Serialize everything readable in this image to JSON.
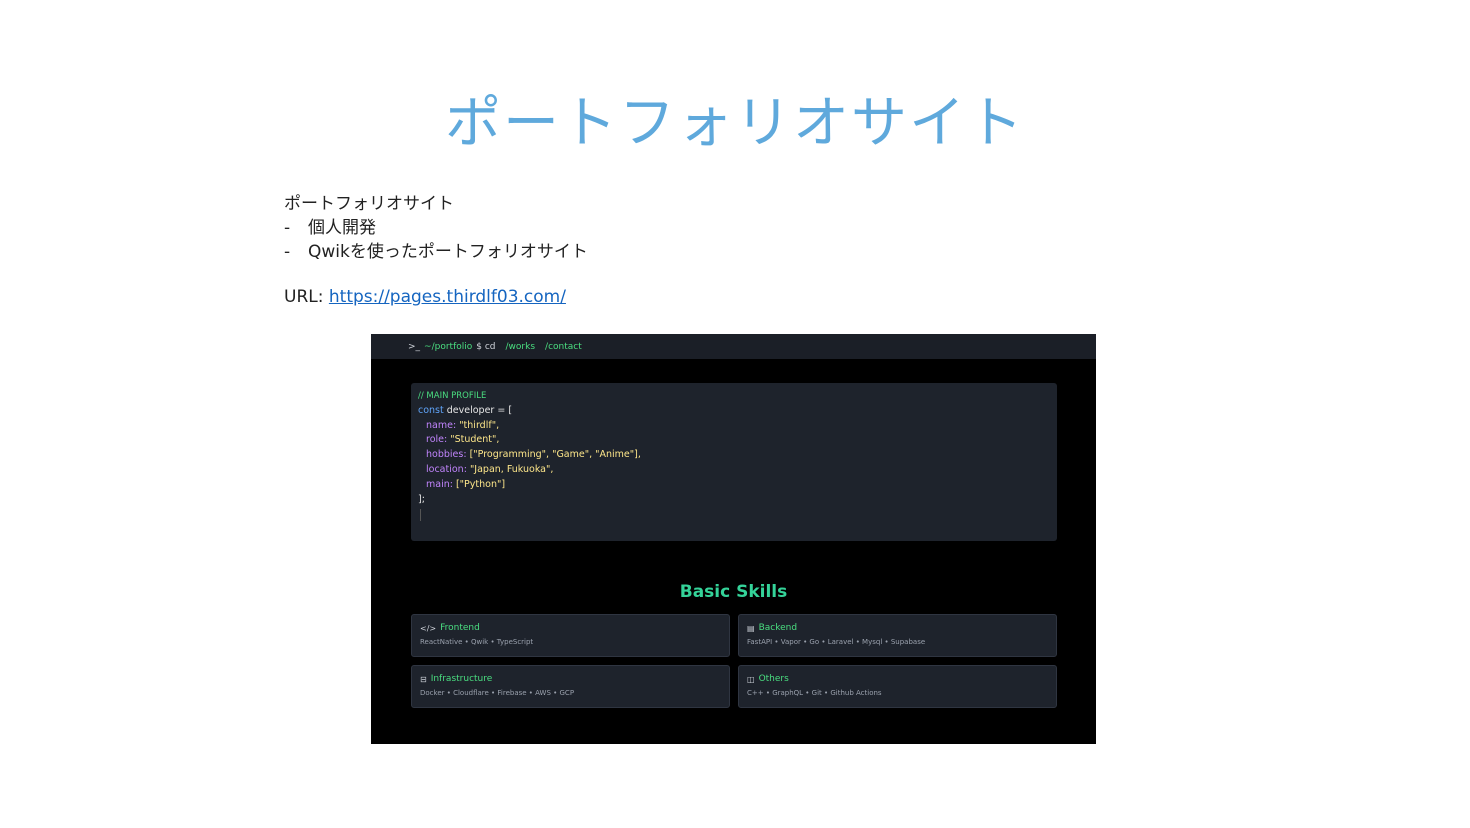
{
  "slide": {
    "title": "ポートフォリオサイト",
    "heading": "ポートフォリオサイト",
    "bullets": [
      "個人開発",
      "Qwikを使ったポートフォリオサイト"
    ],
    "bullet_mark": "-",
    "url_label": "URL:",
    "url": "https://pages.thirdlf03.com/"
  },
  "screenshot": {
    "nav": {
      "prompt": ">_",
      "path": "~/portfolio",
      "command": "$ cd",
      "links": [
        "/works",
        "/contact"
      ]
    },
    "code": {
      "comment": "// MAIN PROFILE",
      "keyword": "const",
      "decl": "developer = [",
      "lines": [
        {
          "key": "name:",
          "value": "\"thirdlf\","
        },
        {
          "key": "role:",
          "value": "\"Student\","
        },
        {
          "key": "hobbies:",
          "value": "[\"Programming\", \"Game\", \"Anime\"],"
        },
        {
          "key": "location:",
          "value": "\"Japan, Fukuoka\","
        },
        {
          "key": "main:",
          "value": "[\"Python\"]"
        }
      ],
      "close": "];"
    },
    "skills_title": "Basic Skills",
    "skills": [
      {
        "icon": "code-icon",
        "glyph": "</>",
        "title": "Frontend",
        "items": "ReactNative • Qwik • TypeScript"
      },
      {
        "icon": "database-icon",
        "glyph": "▤",
        "title": "Backend",
        "items": "FastAPI • Vapor • Go • Laravel • Mysql • Supabase"
      },
      {
        "icon": "server-icon",
        "glyph": "⊟",
        "title": "Infrastructure",
        "items": "Docker • Cloudflare • Firebase • AWS • GCP"
      },
      {
        "icon": "box-icon",
        "glyph": "◫",
        "title": "Others",
        "items": "C++ • GraphQL • Git • Github Actions"
      }
    ]
  },
  "colors": {
    "title": "#5fa9dc",
    "link": "#1565c0",
    "accent_green": "#4ade80",
    "skills_title": "#34d399",
    "card_bg": "#1e232c"
  }
}
